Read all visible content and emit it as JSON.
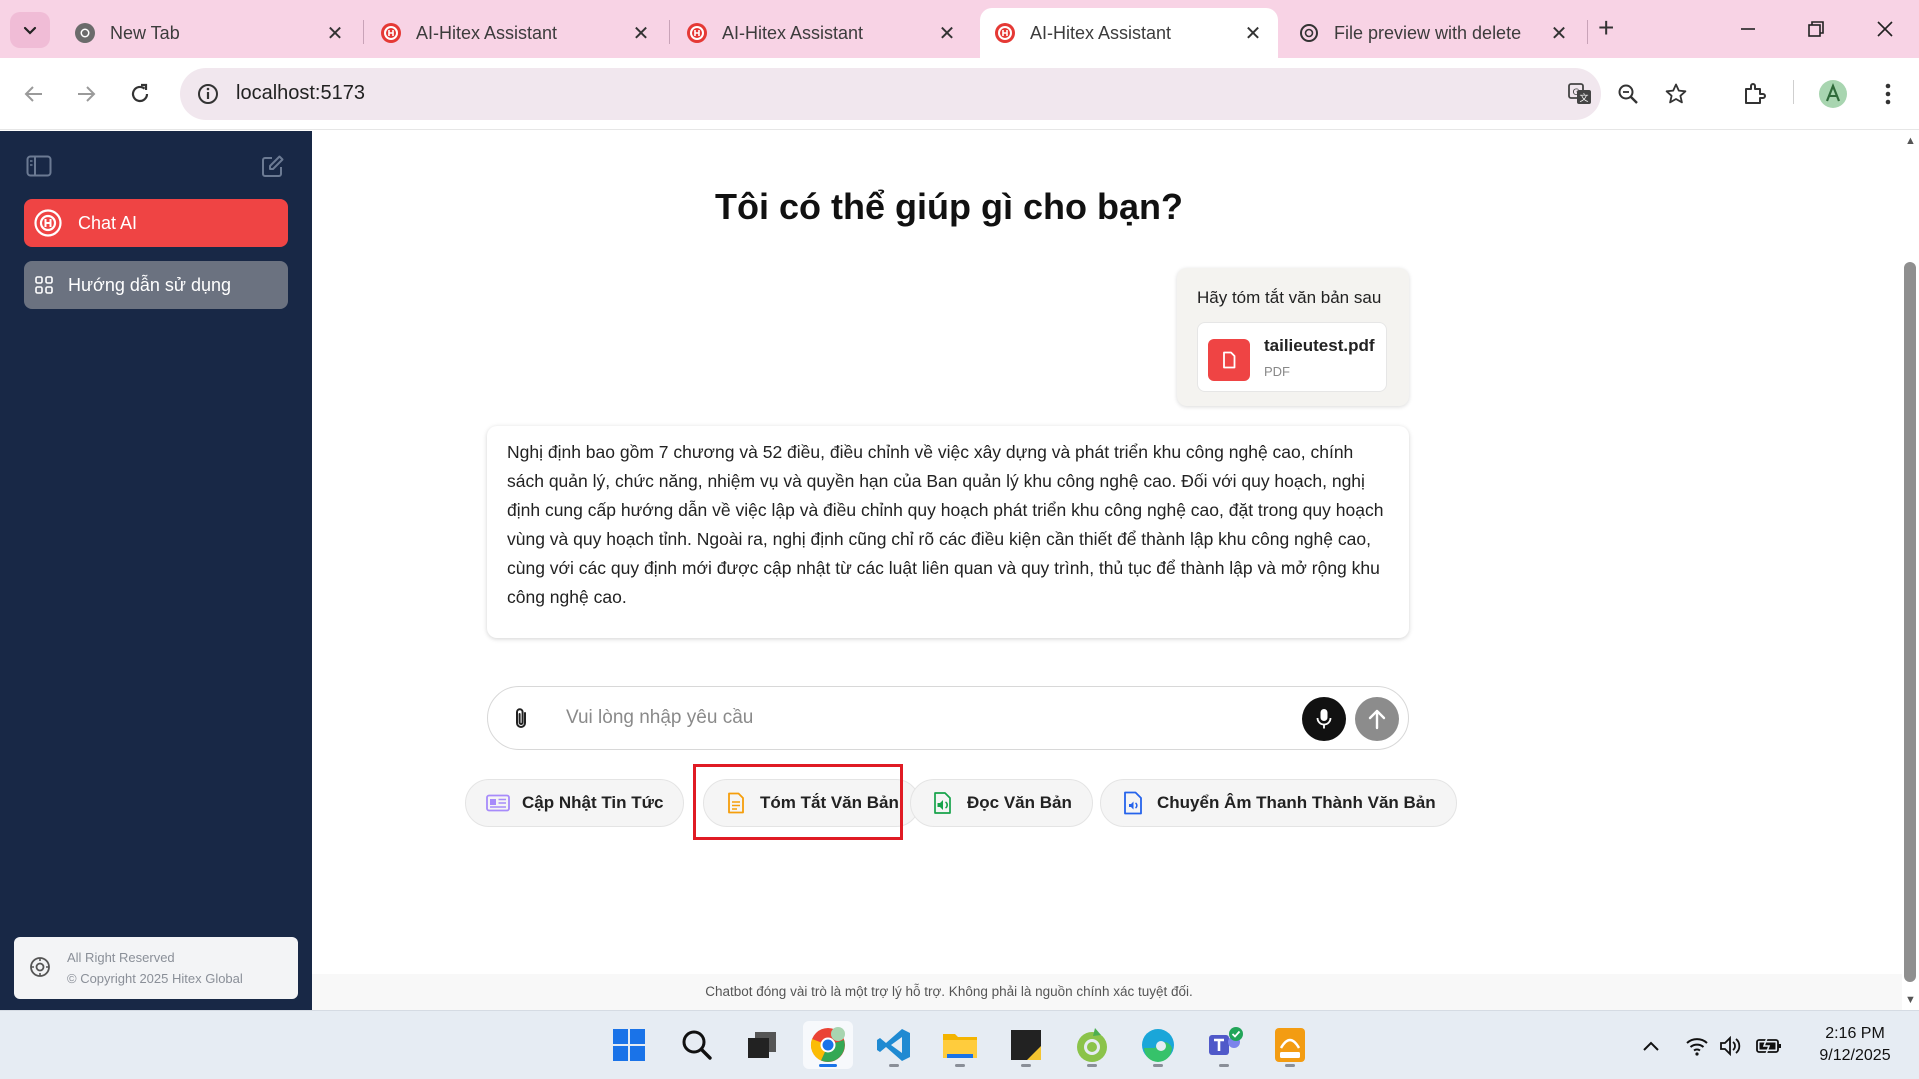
{
  "browser": {
    "tabs": [
      {
        "title": "New Tab",
        "active": false
      },
      {
        "title": "AI-Hitex Assistant",
        "active": false
      },
      {
        "title": "AI-Hitex Assistant",
        "active": false
      },
      {
        "title": "AI-Hitex Assistant",
        "active": true
      },
      {
        "title": "File preview with delete",
        "active": false
      }
    ],
    "url": "localhost:5173"
  },
  "sidebar": {
    "items": [
      {
        "label": "Chat AI",
        "icon": "hitex-logo-icon",
        "active": true
      },
      {
        "label": "Hướng dẫn sử dụng",
        "icon": "grid-icon",
        "active": false
      }
    ],
    "footer": {
      "line1": "All Right Reserved",
      "line2": "© Copyright 2025 Hitex Global"
    }
  },
  "main": {
    "heading": "Tôi có thể giúp gì cho bạn?",
    "user_message": {
      "text": "Hãy tóm tắt văn bản sau",
      "file_name": "tailieutest.pdf",
      "file_type": "PDF"
    },
    "ai_message": "Nghị định bao gồm 7 chương và 52 điều, điều chỉnh về việc xây dựng và phát triển khu công nghệ cao, chính sách quản lý, chức năng, nhiệm vụ và quyền hạn của Ban quản lý khu công nghệ cao. Đối với quy hoạch, nghị định cung cấp hướng dẫn về việc lập và điều chỉnh quy hoạch phát triển khu công nghệ cao, đặt trong quy hoạch vùng và quy hoạch tỉnh. Ngoài ra, nghị định cũng chỉ rõ các điều kiện cần thiết để thành lập khu công nghệ cao, cùng với các quy định mới được cập nhật từ các luật liên quan và quy trình, thủ tục để thành lập và mở rộng khu công nghệ cao.",
    "input": {
      "placeholder": "Vui lòng nhập yêu cầu",
      "value": ""
    },
    "chips": [
      {
        "label": "Cập Nhật Tin Tức",
        "icon": "news-icon",
        "color": "#a78bfa"
      },
      {
        "label": "Tóm Tắt Văn Bản",
        "icon": "document-icon",
        "color": "#f59e0b"
      },
      {
        "label": "Đọc Văn Bản",
        "icon": "speaker-document-icon",
        "color": "#16a34a"
      },
      {
        "label": "Chuyển Âm Thanh Thành Văn Bản",
        "icon": "audio-file-icon",
        "color": "#2563eb"
      }
    ],
    "disclaimer": "Chatbot đóng vài trò là một trợ lý hỗ trợ. Không phải là nguồn chính xác tuyệt đối."
  },
  "taskbar": {
    "apps": [
      "windows-start-icon",
      "search-icon",
      "task-view-icon",
      "chrome-icon",
      "vscode-icon",
      "file-explorer-icon",
      "sticky-notes-icon",
      "coccoc-icon",
      "edge-icon",
      "teams-icon",
      "pdf-reader-icon"
    ],
    "time": "2:16 PM",
    "date": "9/12/2025"
  },
  "colors": {
    "accent": "#ef4444",
    "sidebar_bg": "#182846",
    "tabbar_bg": "#f8d3e5",
    "highlight_box": "#e01b24"
  }
}
